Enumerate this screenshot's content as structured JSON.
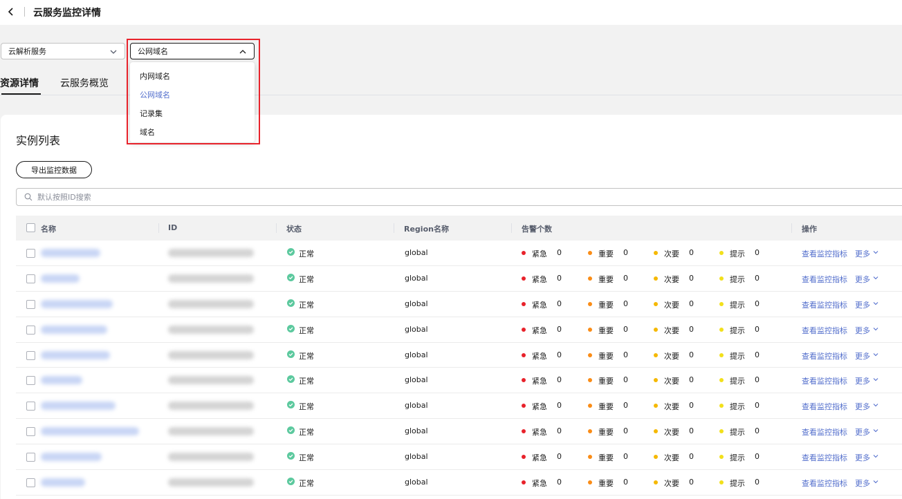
{
  "header": {
    "title": "云服务监控详情"
  },
  "filters": {
    "service_select": "云解析服务",
    "type_select": "公网域名",
    "options": [
      "内网域名",
      "公网域名",
      "记录集",
      "域名"
    ],
    "selected_index": 1
  },
  "tabs": [
    {
      "label": "资源详情",
      "active": true
    },
    {
      "label": "云服务概览",
      "active": false
    }
  ],
  "instances": {
    "title": "实例列表",
    "export_label": "导出监控数据",
    "search_placeholder": "默认按照ID搜索",
    "columns": {
      "name": "名称",
      "id": "ID",
      "status": "状态",
      "region": "Region名称",
      "alarms": "告警个数",
      "actions": "操作"
    },
    "rows": [
      {
        "status": "正常",
        "region": "global",
        "urgent": "0",
        "important": "0",
        "minor": "0",
        "hint": "0"
      },
      {
        "status": "正常",
        "region": "global",
        "urgent": "0",
        "important": "0",
        "minor": "0",
        "hint": "0"
      },
      {
        "status": "正常",
        "region": "global",
        "urgent": "0",
        "important": "0",
        "minor": "0",
        "hint": "0"
      },
      {
        "status": "正常",
        "region": "global",
        "urgent": "0",
        "important": "0",
        "minor": "0",
        "hint": "0"
      },
      {
        "status": "正常",
        "region": "global",
        "urgent": "0",
        "important": "0",
        "minor": "0",
        "hint": "0"
      },
      {
        "status": "正常",
        "region": "global",
        "urgent": "0",
        "important": "0",
        "minor": "0",
        "hint": "0"
      },
      {
        "status": "正常",
        "region": "global",
        "urgent": "0",
        "important": "0",
        "minor": "0",
        "hint": "0"
      },
      {
        "status": "正常",
        "region": "global",
        "urgent": "0",
        "important": "0",
        "minor": "0",
        "hint": "0"
      },
      {
        "status": "正常",
        "region": "global",
        "urgent": "0",
        "important": "0",
        "minor": "0",
        "hint": "0"
      },
      {
        "status": "正常",
        "region": "global",
        "urgent": "0",
        "important": "0",
        "minor": "0",
        "hint": "0"
      }
    ]
  },
  "alarm_labels": {
    "urgent": "紧急",
    "important": "重要",
    "minor": "次要",
    "hint": "提示"
  },
  "actions": {
    "view_metrics": "查看监控指标",
    "more": "更多"
  },
  "colors": {
    "urgent": "#e8222b",
    "important": "#fa8c16",
    "minor": "#f5b800",
    "hint": "#f2e01b",
    "status_ok": "#5cc99e",
    "link": "#526ecc",
    "highlight": "#e8222b"
  },
  "icons": {
    "back": "chevron-left-icon",
    "select": "chevron-down-icon",
    "select_open": "chevron-up-icon",
    "search": "search-icon",
    "status": "check-circle-icon",
    "more": "chevron-down-icon"
  }
}
